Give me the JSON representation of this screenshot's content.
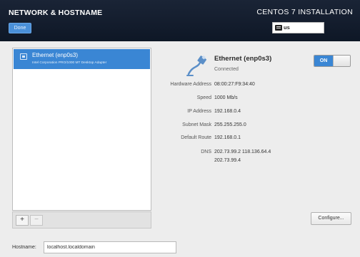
{
  "header": {
    "title": "NETWORK & HOSTNAME",
    "done_label": "Done",
    "install_title": "CENTOS 7 INSTALLATION",
    "keyboard_layout": "us"
  },
  "devices": {
    "items": [
      {
        "name": "Ethernet (enp0s3)",
        "description": "Intel Corporation PRO/1000 MT Desktop Adapter"
      }
    ],
    "add_label": "+",
    "remove_label": "−"
  },
  "detail": {
    "name": "Ethernet (enp0s3)",
    "status": "Connected",
    "toggle_label": "ON",
    "properties": [
      {
        "label": "Hardware Address",
        "value": "08:00:27:F9:34:40"
      },
      {
        "label": "Speed",
        "value": "1000 Mb/s"
      },
      {
        "label": "IP Address",
        "value": "192.168.0.4"
      },
      {
        "label": "Subnet Mask",
        "value": "255.255.255.0"
      },
      {
        "label": "Default Route",
        "value": "192.168.0.1"
      },
      {
        "label": "DNS",
        "value": "202.73.99.2 118.136.64.4",
        "value2": "202.73.99.4"
      }
    ],
    "configure_label": "Configure..."
  },
  "hostname": {
    "label": "Hostname:",
    "value": "localhost.localdomain"
  },
  "colors": {
    "header_bg": "#121c2e",
    "accent": "#3a86d4"
  }
}
